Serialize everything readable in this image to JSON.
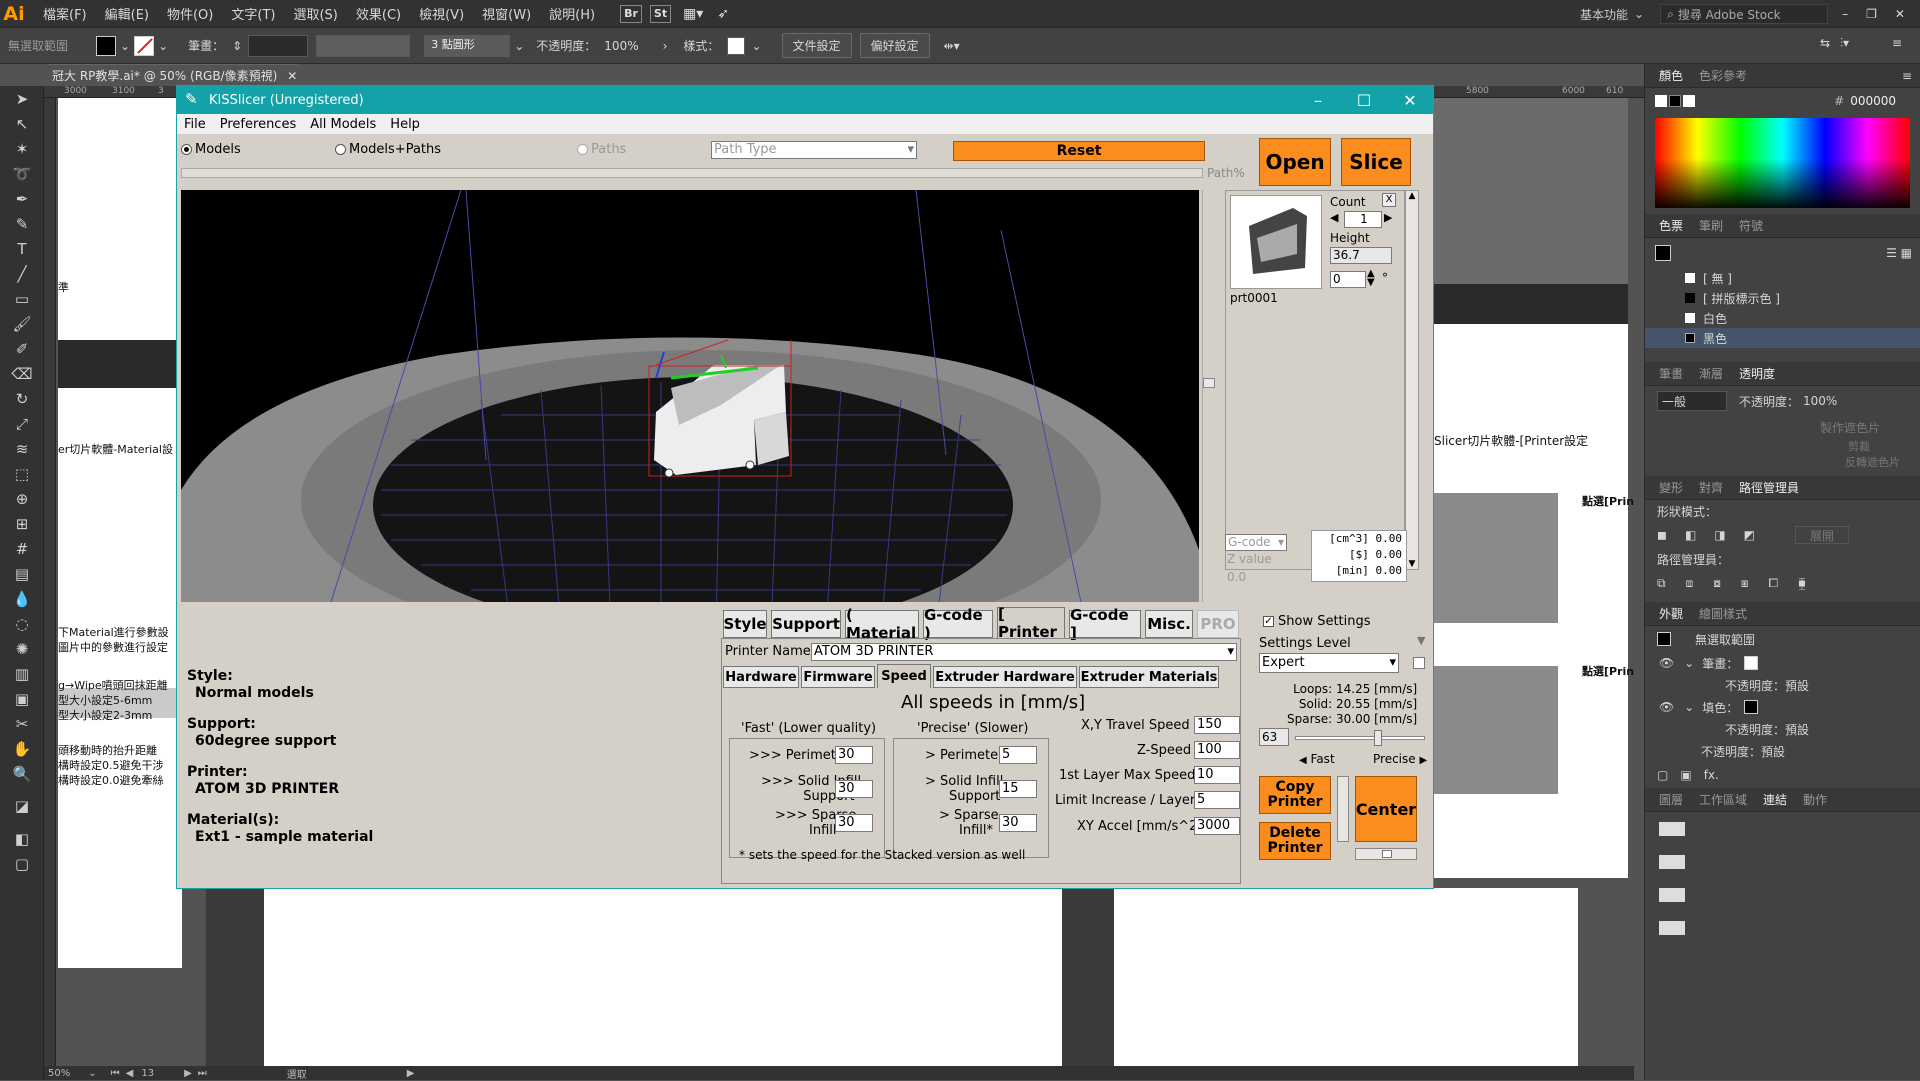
{
  "illustrator": {
    "logo": "Ai",
    "menus": [
      "檔案(F)",
      "編輯(E)",
      "物件(O)",
      "文字(T)",
      "選取(S)",
      "效果(C)",
      "檢視(V)",
      "視窗(W)",
      "說明(H)"
    ],
    "bridge_btn": "Br",
    "stock_btn": "St",
    "workspace": "基本功能",
    "search_placeholder": "搜尋 Adobe Stock",
    "control": {
      "no_selection": "無選取範圍",
      "stroke_label": "筆畫：",
      "brush": "3 點圓形",
      "opacity_label": "不透明度：",
      "opacity_value": "100%",
      "style_label": "樣式：",
      "doc_setup": "文件設定",
      "preferences": "偏好設定"
    },
    "doc_tab": "冠大 RP教學.ai* @ 50% (RGB/像素預視)",
    "ruler_ticks": [
      "3000",
      "3100",
      "3",
      "5800",
      "6000",
      "610"
    ],
    "status": {
      "zoom": "50%",
      "page": "13",
      "mode": "選取"
    },
    "doc_texts": {
      "t1": "準",
      "t2": "er切片軟體-Material設",
      "t3": "下Material進行參數設",
      "t4": "圖片中的參數進行設定",
      "t5": "g→Wipe噴頭回抹距離",
      "t6": "型大小設定5-6mm",
      "t7": "型大小設定2-3mm",
      "t8": "頭移動時的抬升距離",
      "t9": "構時設定0.5避免干涉",
      "t10": "構時設定0.0避免牽絲",
      "r1": "Slicer切片軟體-[Printer設定",
      "r2": "點選[Prin",
      "r3": "點選[Prin"
    },
    "panel": {
      "color_tabs": [
        "顏色",
        "色彩參考"
      ],
      "hex": "000000",
      "swatch_tabs": [
        "色票",
        "筆刷",
        "符號"
      ],
      "swatches": [
        "[ 無 ]",
        "[ 拼版標示色 ]",
        "白色",
        "黑色"
      ],
      "transparency_tabs": [
        "筆畫",
        "漸層",
        "透明度"
      ],
      "blend_mode": "一般",
      "opacity_label": "不透明度：",
      "opacity_value": "100%",
      "make_mask": "製作遮色片",
      "clip": "剪裁",
      "invert": "反轉遮色片",
      "pathfinder_tabs": [
        "變形",
        "對齊",
        "路徑管理員"
      ],
      "shape_modes": "形狀模式：",
      "expand": "展開",
      "pathfinders": "路徑管理員：",
      "appearance_tabs": [
        "外觀",
        "繪圖樣式"
      ],
      "appearance_title": "無選取範圍",
      "stroke_label": "筆畫：",
      "opacity_default": "不透明度：預設",
      "fill_label": "填色：",
      "opacity_default2": "不透明度：預設",
      "opacity_default3": "不透明度：預設",
      "layers_tabs": [
        "圖層",
        "工作區域",
        "連結",
        "動作"
      ]
    }
  },
  "kisslicer": {
    "title": "KISSlicer (Unregistered)",
    "menu": [
      "File",
      "Preferences",
      "All Models",
      "Help"
    ],
    "view_modes": [
      {
        "label": "Models",
        "selected": true
      },
      {
        "label": "Models+Paths",
        "selected": false
      },
      {
        "label": "Paths",
        "selected": false
      }
    ],
    "path_type": "Path Type",
    "reset": "Reset",
    "open": "Open",
    "slice": "Slice",
    "path_pct": "Path%",
    "model": {
      "name": "prt0001",
      "count_label": "Count",
      "count": "1",
      "height_label": "Height",
      "height": "36.7",
      "rotation": "0",
      "deg": "°",
      "close": "X"
    },
    "gcode_label": "G-code",
    "zvalue_label": "Z value",
    "zvalue": "0.0",
    "stats": [
      "[cm^3] 0.00",
      "[$] 0.00",
      "[min] 0.00"
    ],
    "tabs": [
      "Style",
      "Support",
      "( Material",
      "G-code )",
      "[ Printer",
      "G-code ]",
      "Misc.",
      "PRO"
    ],
    "active_tab": "[ Printer",
    "printer_name_label": "Printer Name",
    "printer_name": "ATOM 3D PRINTER",
    "subtabs": [
      "Hardware",
      "Firmware",
      "Speed",
      "Extruder Hardware",
      "Extruder Materials"
    ],
    "active_subtab": "Speed",
    "speed_title": "All speeds in [mm/s]",
    "fast_title": "'Fast' (Lower quality)",
    "precise_title": "'Precise' (Slower)",
    "fast": {
      "perimeter_label": ">>> Perimeter",
      "perimeter": "30",
      "solid_label1": ">>> Solid Infill",
      "solid_label2": "Support*",
      "solid": "30",
      "sparse_label1": ">>> Sparse",
      "sparse_label2": "Infill*",
      "sparse": "30"
    },
    "precise": {
      "perimeter_label": "> Perimeter",
      "perimeter": "5",
      "solid_label1": "> Solid Infill",
      "solid_label2": "Support*",
      "solid": "15",
      "sparse_label1": "> Sparse",
      "sparse_label2": "Infill*",
      "sparse": "30"
    },
    "right_fields": [
      {
        "label": "X,Y Travel Speed",
        "value": "150"
      },
      {
        "label": "Z-Speed",
        "value": "100"
      },
      {
        "label": "1st Layer Max Speed",
        "value": "10"
      },
      {
        "label": "Limit Increase / Layer",
        "value": "5"
      },
      {
        "label": "XY Accel [mm/s^2]",
        "value": "3000"
      }
    ],
    "footnote": "* sets the speed for the Stacked version as well",
    "show_settings": "Show Settings",
    "settings_level_label": "Settings Level",
    "settings_level": "Expert",
    "speed_info": [
      "Loops:  14.25 [mm/s]",
      "Solid:  20.55 [mm/s]",
      "Sparse: 30.00 [mm/s]"
    ],
    "speed_slider_value": "63",
    "fast_label": "Fast",
    "precise_label": "Precise",
    "copy_printer": "Copy Printer",
    "delete_printer": "Delete Printer",
    "center": "Center",
    "summary": {
      "style_h": "Style:",
      "style_v": "Normal models",
      "support_h": "Support:",
      "support_v": "60degree support",
      "printer_h": "Printer:",
      "printer_v": "ATOM 3D PRINTER",
      "material_h": "Material(s):",
      "material_v": "Ext1 - sample material"
    },
    "accent": "#FB8C1E",
    "title_color": "#13A2A8"
  }
}
